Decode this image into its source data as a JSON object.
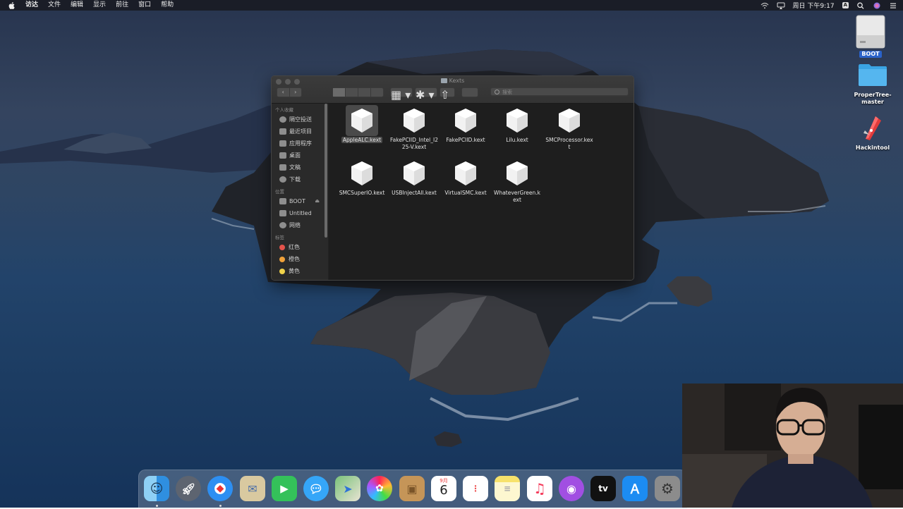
{
  "menubar": {
    "items": [
      "访达",
      "文件",
      "编辑",
      "显示",
      "前往",
      "窗口",
      "帮助"
    ],
    "clock": "周日 下午9:17",
    "input_source": "A"
  },
  "desktop": {
    "items": [
      {
        "label": "BOOT",
        "selected": true
      },
      {
        "label": "ProperTree-master"
      },
      {
        "label": "Hackintool"
      }
    ]
  },
  "finder": {
    "title": "Kexts",
    "search_placeholder": "搜索",
    "sidebar": {
      "favorites_header": "个人收藏",
      "favorites": [
        "隔空投送",
        "最近项目",
        "应用程序",
        "桌面",
        "文稿",
        "下载"
      ],
      "locations_header": "位置",
      "locations": [
        "BOOT",
        "Untitled",
        "网络"
      ],
      "tags_header": "标签",
      "tags": [
        {
          "label": "红色",
          "color": "#e5534b"
        },
        {
          "label": "橙色",
          "color": "#f0a13a"
        },
        {
          "label": "黄色",
          "color": "#f0d24a"
        }
      ]
    },
    "files": [
      {
        "name": "AppleALC.kext",
        "selected": true
      },
      {
        "name": "FakePCIID_Intel_I225-V.kext"
      },
      {
        "name": "FakePCIID.kext"
      },
      {
        "name": "Lilu.kext"
      },
      {
        "name": "SMCProcessor.kext"
      },
      {
        "name": "SMCSuperIO.kext"
      },
      {
        "name": "USBInjectAll.kext"
      },
      {
        "name": "VirtualSMC.kext"
      },
      {
        "name": "WhateverGreen.kext"
      }
    ]
  },
  "dock": {
    "apps": [
      "finder",
      "launchpad",
      "safari",
      "mail",
      "facetime",
      "messages",
      "maps",
      "photos",
      "contacts",
      "calendar",
      "reminders",
      "notes",
      "music",
      "podcasts",
      "tv",
      "app-store",
      "system-preferences"
    ],
    "calendar_month": "9月",
    "calendar_day": "6",
    "tv_label": "tv"
  },
  "colors": {
    "selection": "#2a62c9",
    "window_bg": "#1e1e1e",
    "sidebar_bg": "#2a2a2a"
  }
}
